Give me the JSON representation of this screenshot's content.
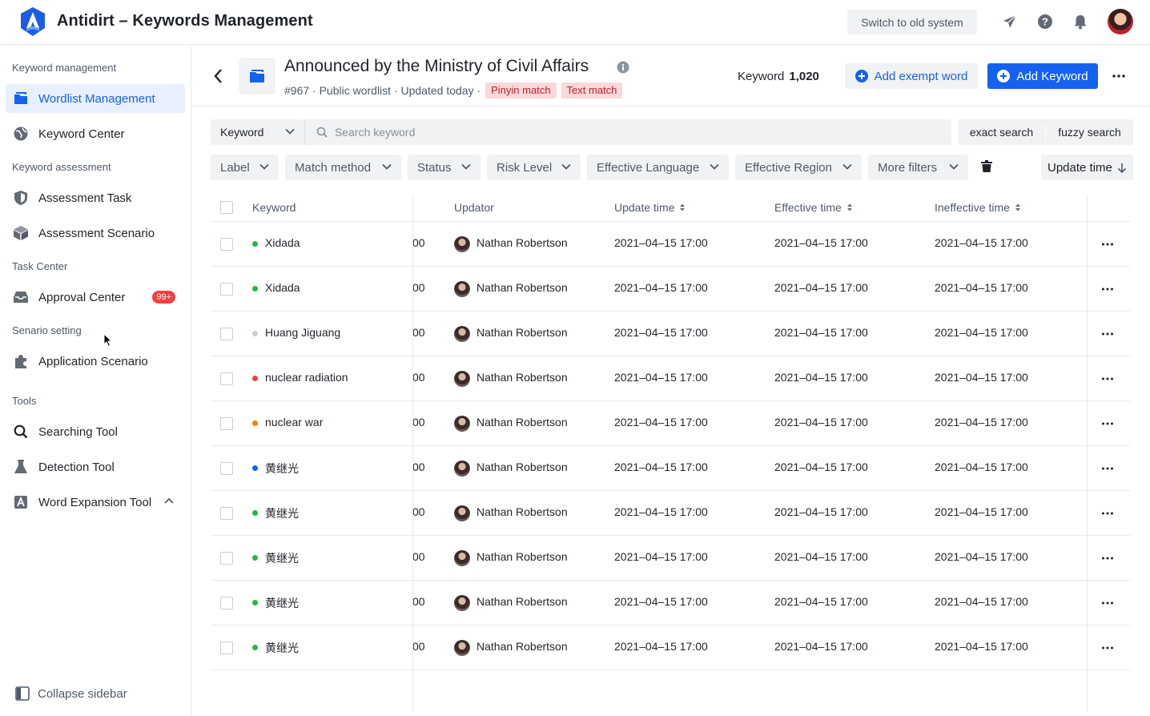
{
  "app": {
    "title": "Antidirt – Keywords Management",
    "switch_label": "Switch to old system"
  },
  "sidebar": {
    "sections": [
      {
        "label": "Keyword management"
      },
      {
        "label": "Keyword assessment"
      },
      {
        "label": "Task Center"
      },
      {
        "label": "Senario setting"
      },
      {
        "label": "Tools"
      }
    ],
    "items": [
      {
        "label": "Wordlist Management",
        "icon": "wordlist-icon"
      },
      {
        "label": "Keyword Center",
        "icon": "globe-icon"
      },
      {
        "label": "Assessment Task",
        "icon": "shield-icon"
      },
      {
        "label": "Assessment Scenario",
        "icon": "cube-icon"
      },
      {
        "label": "Approval Center",
        "icon": "inbox-icon",
        "badge": "99+"
      },
      {
        "label": "Application Scenario",
        "icon": "puzzle-icon"
      },
      {
        "label": "Searching Tool",
        "icon": "search-icon"
      },
      {
        "label": "Detection Tool",
        "icon": "flask-icon"
      },
      {
        "label": "Word Expansion Tool",
        "icon": "font-icon"
      }
    ],
    "collapse_label": "Collapse sidebar"
  },
  "header": {
    "title": "Announced by the Ministry of Civil Affairs",
    "meta": "#967 · Public wordlist · Updated today ·",
    "tags": [
      "Pinyin match",
      "Text match"
    ],
    "keyword_label": "Keyword",
    "keyword_count": "1,020",
    "add_exempt_label": "Add exempt word",
    "add_keyword_label": "Add Keyword"
  },
  "search": {
    "type_label": "Keyword",
    "placeholder": "Search keyword",
    "modes": [
      "exact search",
      "fuzzy search"
    ]
  },
  "filters": [
    "Label",
    "Match method",
    "Status",
    "Risk Level",
    "Effective Language",
    "Effective Region",
    "More filters"
  ],
  "sort_label": "Update time",
  "table": {
    "columns": [
      "Keyword",
      "Updator",
      "Update time",
      "Effective time",
      "Ineffective time"
    ],
    "rows": [
      {
        "keyword": "Xidada",
        "dot": "#2bb24c",
        "frag": "00",
        "updator": "Nathan Robertson",
        "update": "2021–04–15 17:00",
        "effective": "2021–04–15 17:00",
        "ineffective": "2021–04–15 17:00"
      },
      {
        "keyword": "Xidada",
        "dot": "#2bb24c",
        "frag": "00",
        "updator": "Nathan Robertson",
        "update": "2021–04–15 17:00",
        "effective": "2021–04–15 17:00",
        "ineffective": "2021–04–15 17:00"
      },
      {
        "keyword": "Huang Jiguang",
        "dot": "#c9cdd4",
        "frag": "00",
        "updator": "Nathan Robertson",
        "update": "2021–04–15 17:00",
        "effective": "2021–04–15 17:00",
        "ineffective": "2021–04–15 17:00"
      },
      {
        "keyword": "nuclear radiation",
        "dot": "#f53f3f",
        "frag": "00",
        "updator": "Nathan Robertson",
        "update": "2021–04–15 17:00",
        "effective": "2021–04–15 17:00",
        "ineffective": "2021–04–15 17:00"
      },
      {
        "keyword": "nuclear war",
        "dot": "#ff7d00",
        "frag": "00",
        "updator": "Nathan Robertson",
        "update": "2021–04–15 17:00",
        "effective": "2021–04–15 17:00",
        "ineffective": "2021–04–15 17:00"
      },
      {
        "keyword": "黄继光",
        "dot": "#1662f0",
        "frag": "00",
        "updator": "Nathan Robertson",
        "update": "2021–04–15 17:00",
        "effective": "2021–04–15 17:00",
        "ineffective": "2021–04–15 17:00"
      },
      {
        "keyword": "黄继光",
        "dot": "#2bb24c",
        "frag": "00",
        "updator": "Nathan Robertson",
        "update": "2021–04–15 17:00",
        "effective": "2021–04–15 17:00",
        "ineffective": "2021–04–15 17:00"
      },
      {
        "keyword": "黄继光",
        "dot": "#2bb24c",
        "frag": "00",
        "updator": "Nathan Robertson",
        "update": "2021–04–15 17:00",
        "effective": "2021–04–15 17:00",
        "ineffective": "2021–04–15 17:00"
      },
      {
        "keyword": "黄继光",
        "dot": "#2bb24c",
        "frag": "00",
        "updator": "Nathan Robertson",
        "update": "2021–04–15 17:00",
        "effective": "2021–04–15 17:00",
        "ineffective": "2021–04–15 17:00"
      },
      {
        "keyword": "黄继光",
        "dot": "#2bb24c",
        "frag": "00",
        "updator": "Nathan Robertson",
        "update": "2021–04–15 17:00",
        "effective": "2021–04–15 17:00",
        "ineffective": "2021–04–15 17:00"
      }
    ]
  },
  "colors": {
    "accent": "#1662f0",
    "tag_bg": "#fdd8d9",
    "tag_text": "#c22029",
    "badge": "#f53f3f"
  }
}
